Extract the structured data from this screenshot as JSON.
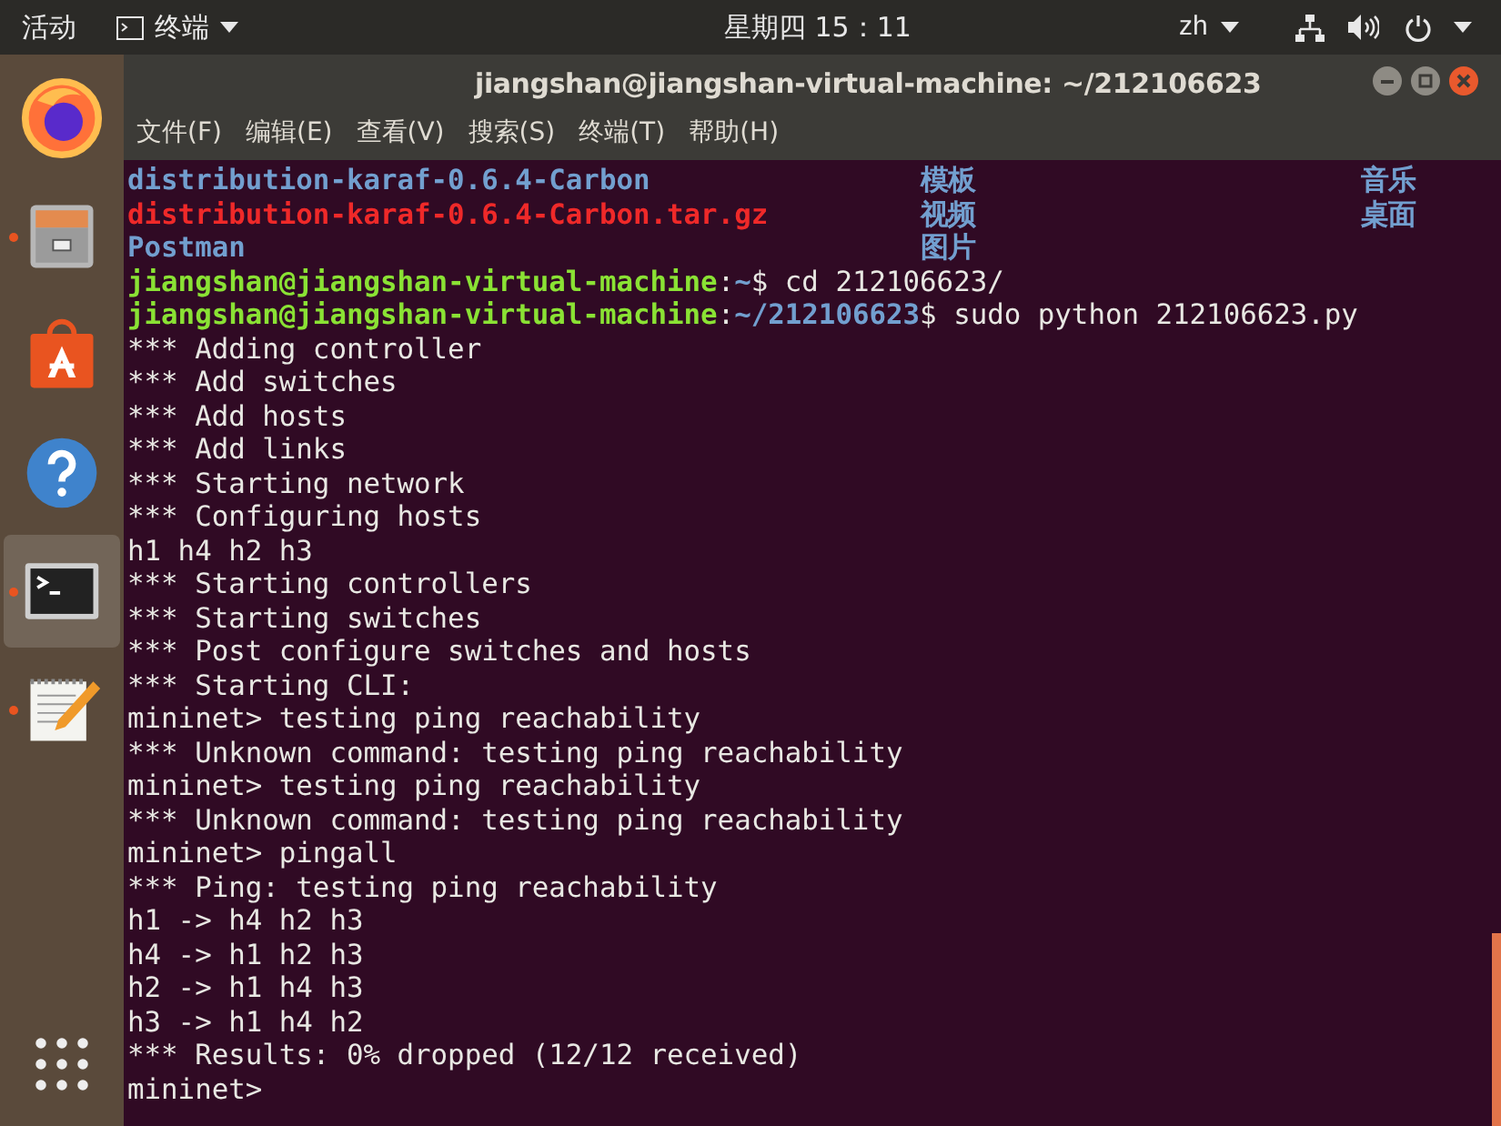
{
  "top_bar": {
    "activities": "活动",
    "app_menu": "终端",
    "clock": "星期四 15：11",
    "input_method": "zh"
  },
  "dock": {
    "items": [
      {
        "kind": "browser",
        "running": false,
        "selected": false
      },
      {
        "kind": "files",
        "running": true,
        "selected": false
      },
      {
        "kind": "software",
        "running": false,
        "selected": false
      },
      {
        "kind": "help",
        "running": false,
        "selected": false
      },
      {
        "kind": "terminal",
        "running": true,
        "selected": true
      },
      {
        "kind": "editor",
        "running": true,
        "selected": false
      },
      {
        "kind": "apps",
        "running": false,
        "selected": false
      }
    ]
  },
  "window": {
    "title": "jiangshan@jiangshan-virtual-machine: ~/212106623",
    "menu": [
      "文件(F)",
      "编辑(E)",
      "查看(V)",
      "搜索(S)",
      "终端(T)",
      "帮助(H)"
    ]
  },
  "terminal": {
    "lines": [
      {
        "kind": "ls",
        "entries": [
          {
            "text": "distribution-karaf-0.6.4-Carbon",
            "kind": "dir"
          },
          {
            "text": "模板",
            "kind": "dir"
          },
          {
            "text": "音乐",
            "kind": "dir"
          }
        ]
      },
      {
        "kind": "ls",
        "entries": [
          {
            "text": "distribution-karaf-0.6.4-Carbon.tar.gz",
            "kind": "archive"
          },
          {
            "text": "视频",
            "kind": "dir"
          },
          {
            "text": "桌面",
            "kind": "dir"
          }
        ]
      },
      {
        "kind": "ls",
        "entries": [
          {
            "text": "Postman",
            "kind": "dir"
          },
          {
            "text": "图片",
            "kind": "dir"
          }
        ]
      },
      {
        "kind": "text",
        "segments": [
          {
            "text": "jiangshan@jiangshan-virtual-machine",
            "kind": "user"
          },
          {
            "text": ":",
            "kind": "plain"
          },
          {
            "text": "~",
            "kind": "path"
          },
          {
            "text": "$ cd 212106623/",
            "kind": "plain"
          }
        ]
      },
      {
        "kind": "text",
        "segments": [
          {
            "text": "jiangshan@jiangshan-virtual-machine",
            "kind": "user"
          },
          {
            "text": ":",
            "kind": "plain"
          },
          {
            "text": "~/212106623",
            "kind": "path"
          },
          {
            "text": "$ sudo python 212106623.py",
            "kind": "plain"
          }
        ]
      },
      {
        "kind": "text",
        "segments": [
          {
            "text": "*** Adding controller",
            "kind": "plain"
          }
        ]
      },
      {
        "kind": "text",
        "segments": [
          {
            "text": "*** Add switches",
            "kind": "plain"
          }
        ]
      },
      {
        "kind": "text",
        "segments": [
          {
            "text": "*** Add hosts",
            "kind": "plain"
          }
        ]
      },
      {
        "kind": "text",
        "segments": [
          {
            "text": "*** Add links",
            "kind": "plain"
          }
        ]
      },
      {
        "kind": "text",
        "segments": [
          {
            "text": "*** Starting network",
            "kind": "plain"
          }
        ]
      },
      {
        "kind": "text",
        "segments": [
          {
            "text": "*** Configuring hosts",
            "kind": "plain"
          }
        ]
      },
      {
        "kind": "text",
        "segments": [
          {
            "text": "h1 h4 h2 h3",
            "kind": "plain"
          }
        ]
      },
      {
        "kind": "text",
        "segments": [
          {
            "text": "*** Starting controllers",
            "kind": "plain"
          }
        ]
      },
      {
        "kind": "text",
        "segments": [
          {
            "text": "*** Starting switches",
            "kind": "plain"
          }
        ]
      },
      {
        "kind": "text",
        "segments": [
          {
            "text": "*** Post configure switches and hosts",
            "kind": "plain"
          }
        ]
      },
      {
        "kind": "text",
        "segments": [
          {
            "text": "*** Starting CLI:",
            "kind": "plain"
          }
        ]
      },
      {
        "kind": "text",
        "segments": [
          {
            "text": "mininet> testing ping reachability",
            "kind": "plain"
          }
        ]
      },
      {
        "kind": "text",
        "segments": [
          {
            "text": "*** Unknown command: testing ping reachability",
            "kind": "plain"
          }
        ]
      },
      {
        "kind": "text",
        "segments": [
          {
            "text": "mininet> testing ping reachability",
            "kind": "plain"
          }
        ]
      },
      {
        "kind": "text",
        "segments": [
          {
            "text": "*** Unknown command: testing ping reachability",
            "kind": "plain"
          }
        ]
      },
      {
        "kind": "text",
        "segments": [
          {
            "text": "mininet> pingall",
            "kind": "plain"
          }
        ]
      },
      {
        "kind": "text",
        "segments": [
          {
            "text": "*** Ping: testing ping reachability",
            "kind": "plain"
          }
        ]
      },
      {
        "kind": "text",
        "segments": [
          {
            "text": "h1 -> h4 h2 h3",
            "kind": "plain"
          }
        ]
      },
      {
        "kind": "text",
        "segments": [
          {
            "text": "h4 -> h1 h2 h3",
            "kind": "plain"
          }
        ]
      },
      {
        "kind": "text",
        "segments": [
          {
            "text": "h2 -> h1 h4 h3",
            "kind": "plain"
          }
        ]
      },
      {
        "kind": "text",
        "segments": [
          {
            "text": "h3 -> h1 h4 h2",
            "kind": "plain"
          }
        ]
      },
      {
        "kind": "text",
        "segments": [
          {
            "text": "*** Results: 0% dropped (12/12 received)",
            "kind": "plain"
          }
        ]
      },
      {
        "kind": "text",
        "segments": [
          {
            "text": "mininet>",
            "kind": "plain"
          }
        ]
      }
    ]
  }
}
